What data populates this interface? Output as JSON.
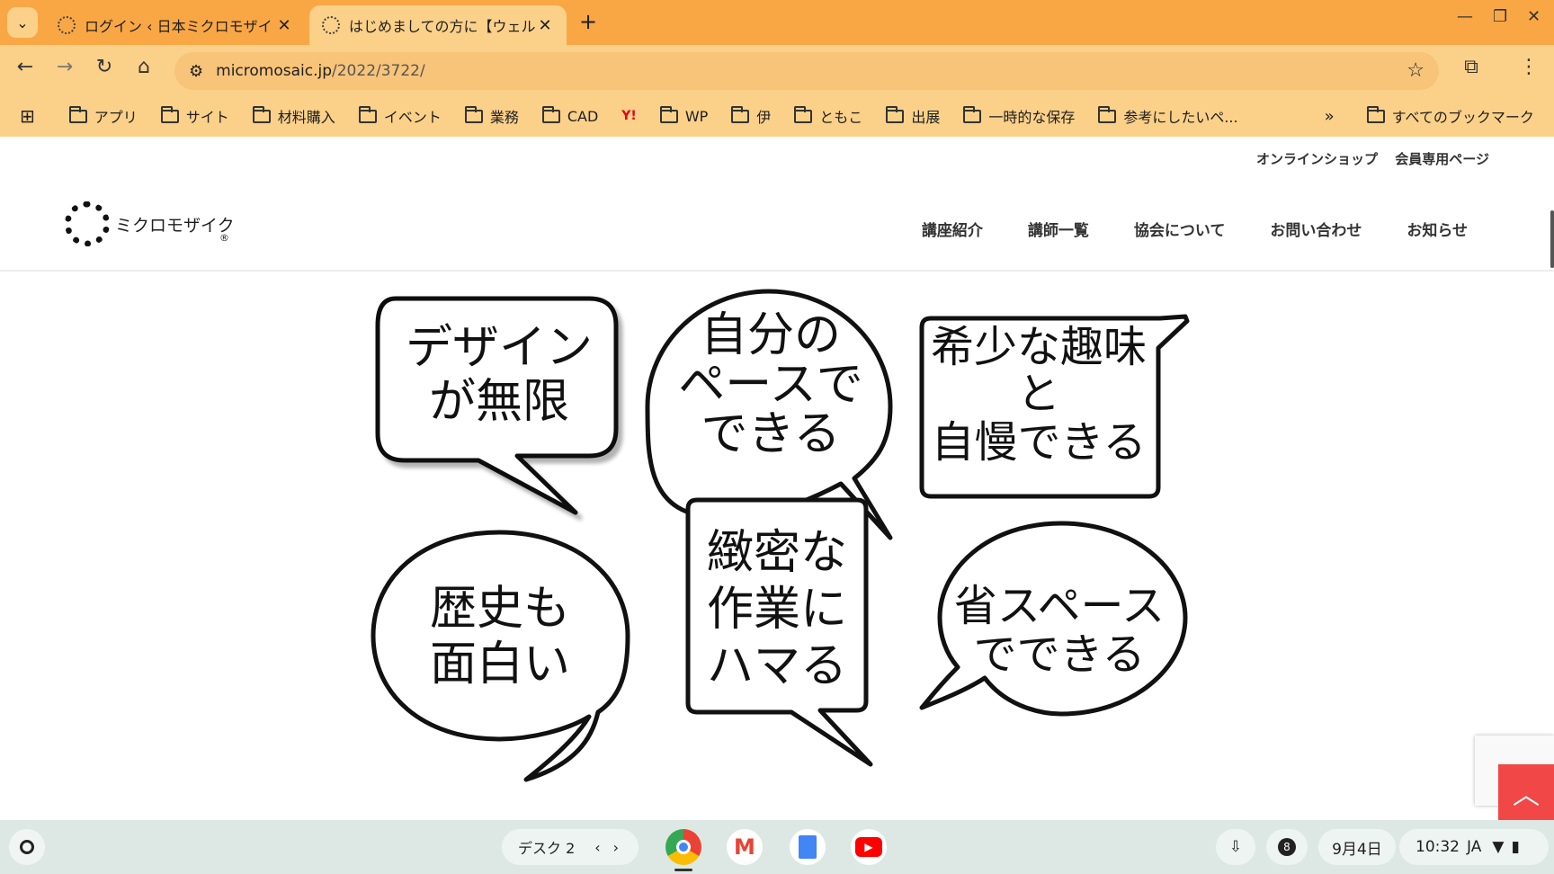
{
  "browser": {
    "tabs": [
      {
        "title": "ログイン ‹ 日本ミクロモザイ",
        "active": false
      },
      {
        "title": "はじめましての方に【ウェル",
        "active": true
      }
    ],
    "url_host": "micromosaic.jp",
    "url_path": "/2022/3722/",
    "bookmarks": [
      "アプリ",
      "サイト",
      "材料購入",
      "イベント",
      "業務",
      "CAD",
      "WP",
      "伊",
      "ともこ",
      "出展",
      "一時的な保存",
      "参考にしたいペ..."
    ],
    "all_bookmarks": "すべてのブックマーク",
    "yahoo_label": "Y!"
  },
  "site": {
    "util_links": [
      "オンラインショップ",
      "会員専用ページ"
    ],
    "logo_text": "ミクロモザイク",
    "logo_mark": "®",
    "nav": [
      "講座紹介",
      "講師一覧",
      "協会について",
      "お問い合わせ",
      "お知らせ"
    ]
  },
  "bubbles": [
    {
      "lines": [
        "デザイン",
        "が無限"
      ]
    },
    {
      "lines": [
        "自分の",
        "ペースで",
        "できる"
      ]
    },
    {
      "lines": [
        "希少な趣味",
        "と",
        "自慢できる"
      ]
    },
    {
      "lines": [
        "歴史も",
        "面白い"
      ]
    },
    {
      "lines": [
        "緻密な",
        "作業に",
        "ハマる"
      ]
    },
    {
      "lines": [
        "省スペース",
        "でできる"
      ]
    }
  ],
  "shelf": {
    "desk_label": "デスク 2",
    "notification_count": "8",
    "date": "9月4日",
    "time": "10:32",
    "ime": "JA"
  }
}
